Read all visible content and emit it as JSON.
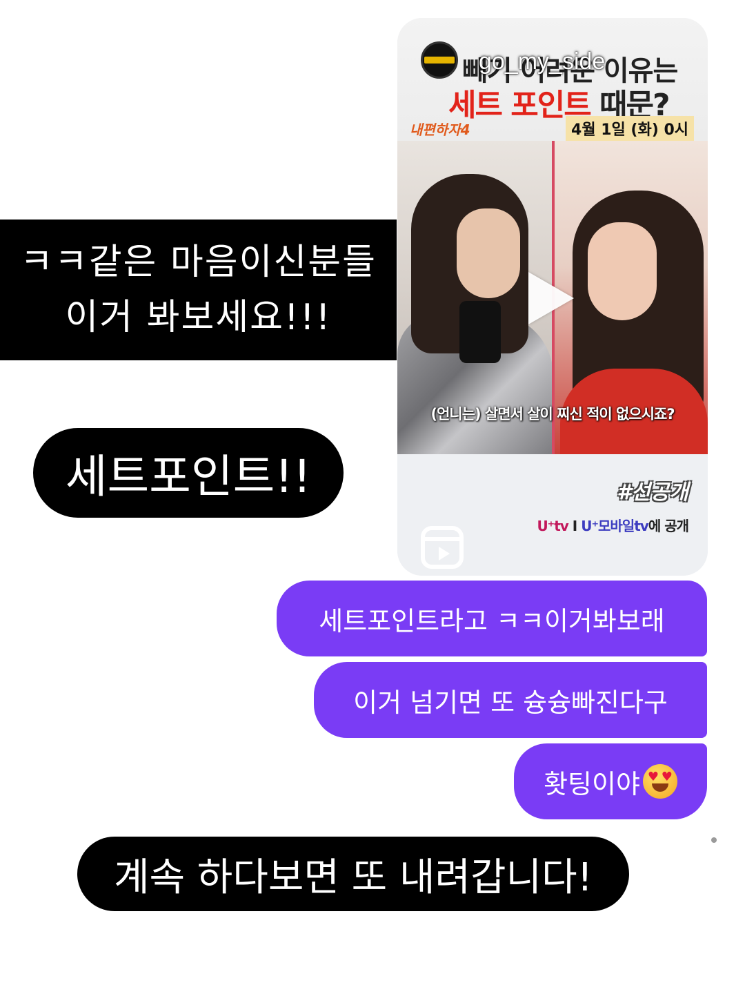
{
  "overlay": {
    "caption_line1": "ㅋㅋ같은  마음이신분들",
    "caption_line2": "이거  봐보세요!!!",
    "pill_top": "세트포인트!!",
    "pill_bottom": "계속 하다보면 또 내려갑니다!"
  },
  "reel": {
    "username": "go_my_side",
    "headline_line1": "빼기 어려운 이유는",
    "headline_line2_red": "세트 포인트",
    "headline_line2_rest": " 때문?",
    "show_logo": "내편하자4",
    "air_date": "4월 1일 (화) 0시",
    "subtitle": "(언니는) 살면서 살이 찌신 적이 없으시죠?",
    "hashtag": "#선공개",
    "platform_1": "U⁺tv",
    "platform_sep": " I ",
    "platform_2": "U⁺모바일tv",
    "platform_3": "에 공개",
    "play_icon": "play-icon",
    "reels_icon": "reels-icon"
  },
  "messages": [
    {
      "text": "세트포인트라고 ㅋㅋ이거봐보래"
    },
    {
      "text": "이거 넘기면 또 슝슝빠진다구"
    },
    {
      "text": "홧팅이야",
      "emoji": "heart-eyes-emoji"
    }
  ],
  "colors": {
    "sent_bubble": "#7a3cf5",
    "overlay_bg": "#000000",
    "headline_red": "#e2231a"
  }
}
